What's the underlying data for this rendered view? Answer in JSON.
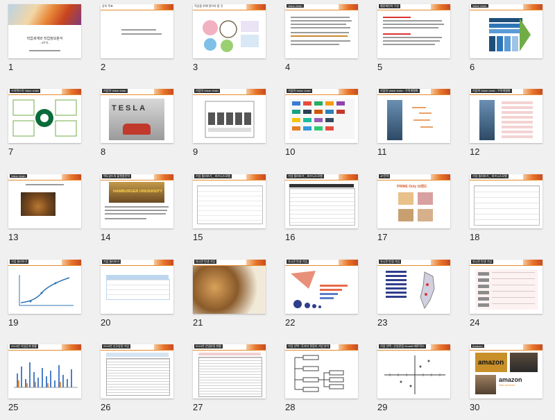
{
  "slides": [
    {
      "number": "1",
      "title": "직업세계와 직업정보분석",
      "subtitle": "- 6주차 -"
    },
    {
      "number": "2",
      "title": "강의 목표"
    },
    {
      "number": "3",
      "title": "직업을 위해 알아야 할 것"
    },
    {
      "number": "4",
      "title": "Value chain"
    },
    {
      "number": "5",
      "title": "벨류체인의 구성"
    },
    {
      "number": "6",
      "title": "Value chain"
    },
    {
      "number": "7",
      "title": "스타벅스의 Value chain"
    },
    {
      "number": "8",
      "title": "기업의 Value chain"
    },
    {
      "number": "9",
      "title": "기업의 Value chain"
    },
    {
      "number": "10",
      "title": "기업의 Value chain"
    },
    {
      "number": "11",
      "title": "기업의 Value chain : 수직계열화"
    },
    {
      "number": "12",
      "title": "기업의 Value chain : 수직계열화"
    },
    {
      "number": "13",
      "title": "Value chain"
    },
    {
      "number": "14",
      "title": "맥도날드의 플랫폼전략"
    },
    {
      "number": "15",
      "title": "기업 둘러보기 _ 비즈니스모델"
    },
    {
      "number": "16",
      "title": "기업 둘러보기 _ 비즈니스모델"
    },
    {
      "number": "17",
      "title": "4P전략"
    },
    {
      "number": "18",
      "title": "기업 둘러보기 _ 비즈니스모델"
    },
    {
      "number": "19",
      "title": "기업 둘러보기"
    },
    {
      "number": "20",
      "title": "기업 둘러보기"
    },
    {
      "number": "21",
      "title": "유니콘 탄생 기업"
    },
    {
      "number": "22",
      "title": "유니콘 탄생 기업"
    },
    {
      "number": "23",
      "title": "유니콘 탄생 기업"
    },
    {
      "number": "24",
      "title": "유니콘 탄생 기업"
    },
    {
      "number": "25",
      "title": "2019년 기업공개 현황"
    },
    {
      "number": "26",
      "title": "2019년 신규상장 기업"
    },
    {
      "number": "27",
      "title": "2019년 산업분류 현황"
    },
    {
      "number": "28",
      "title": "기업 선택 : 투자자 관점의 기업 분석"
    },
    {
      "number": "29",
      "title": "기업 선택 : 산업관점 Growth 매트릭스"
    },
    {
      "number": "30",
      "title": "Amazon"
    }
  ],
  "slide8": {
    "brand": "TESLA"
  },
  "slide14": {
    "banner": "HAMBURGER UNIVERSITY"
  },
  "slide17": {
    "brand": "PRIME Only 브랜드"
  },
  "slide30": {
    "logo_top": "amazon",
    "logo_bottom": "amazon",
    "sub": "web services"
  },
  "colors": {
    "accent": "#e58b2a",
    "background": "#f0f0f0"
  }
}
